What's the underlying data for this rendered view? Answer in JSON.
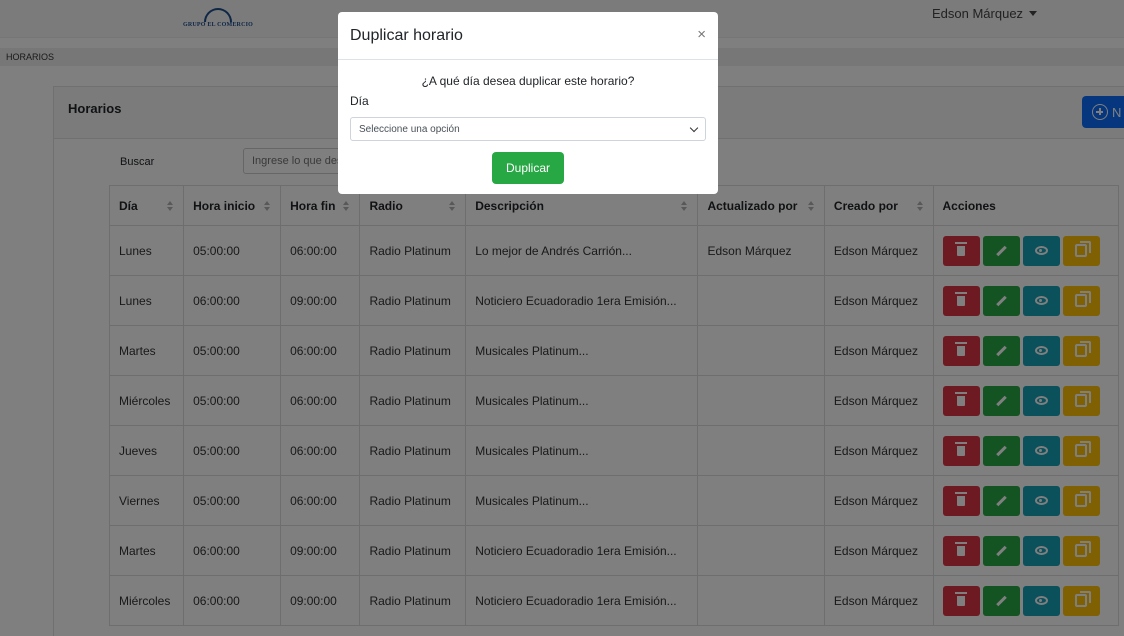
{
  "header": {
    "logo_text": "GRUPO EL COMERCIO",
    "user_name": "Edson Márquez"
  },
  "breadcrumb": {
    "label": "HORARIOS"
  },
  "card": {
    "title": "Horarios",
    "new_button_label": "N"
  },
  "search": {
    "label": "Buscar",
    "placeholder": "Ingrese lo que desea buscar"
  },
  "table": {
    "columns": [
      "Día",
      "Hora inicio",
      "Hora fin",
      "Radio",
      "Descripción",
      "Actualizado por",
      "Creado por",
      "Acciones"
    ],
    "rows": [
      [
        "Lunes",
        "05:00:00",
        "06:00:00",
        "Radio Platinum",
        "Lo mejor de Andrés Carrión...",
        "Edson Márquez",
        "Edson Márquez"
      ],
      [
        "Lunes",
        "06:00:00",
        "09:00:00",
        "Radio Platinum",
        "Noticiero Ecuadoradio 1era Emisión...",
        "",
        "Edson Márquez"
      ],
      [
        "Martes",
        "05:00:00",
        "06:00:00",
        "Radio Platinum",
        "Musicales Platinum...",
        "",
        "Edson Márquez"
      ],
      [
        "Miércoles",
        "05:00:00",
        "06:00:00",
        "Radio Platinum",
        "Musicales Platinum...",
        "",
        "Edson Márquez"
      ],
      [
        "Jueves",
        "05:00:00",
        "06:00:00",
        "Radio Platinum",
        "Musicales Platinum...",
        "",
        "Edson Márquez"
      ],
      [
        "Viernes",
        "05:00:00",
        "06:00:00",
        "Radio Platinum",
        "Musicales Platinum...",
        "",
        "Edson Márquez"
      ],
      [
        "Martes",
        "06:00:00",
        "09:00:00",
        "Radio Platinum",
        "Noticiero Ecuadoradio 1era Emisión...",
        "",
        "Edson Márquez"
      ],
      [
        "Miércoles",
        "06:00:00",
        "09:00:00",
        "Radio Platinum",
        "Noticiero Ecuadoradio 1era Emisión...",
        "",
        "Edson Márquez"
      ]
    ],
    "action_icons": [
      "trash-icon",
      "pencil-icon",
      "eye-icon",
      "copy-icon"
    ]
  },
  "modal": {
    "title": "Duplicar horario",
    "close_glyph": "×",
    "question": "¿A qué día desea duplicar este horario?",
    "day_label": "Día",
    "select_value": "Seleccione una opción",
    "submit_label": "Duplicar"
  },
  "colors": {
    "primary": "#0d6efd",
    "success": "#28a745",
    "danger": "#dc3545",
    "info": "#17a2b8",
    "warning": "#ffc107"
  }
}
